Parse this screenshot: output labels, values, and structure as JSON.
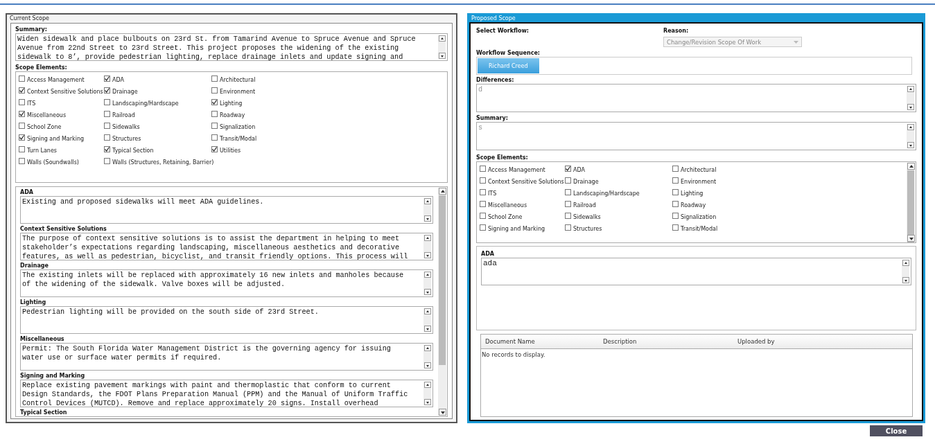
{
  "current_scope": {
    "title": "Current Scope",
    "summary_label": "Summary:",
    "summary": "Widen sidewalk and place bulbouts on 23rd St. from Tamarind Avenue to Spruce Avenue and Spruce\nAvenue from 22nd Street to 23rd Street. This project proposes the widening of the existing\nsidewalk to 8’, provide pedestrian lighting, replace drainage inlets and update signing and",
    "elements_label": "Scope Elements:",
    "elements": [
      {
        "label": "Access Management",
        "checked": false
      },
      {
        "label": "ADA",
        "checked": true
      },
      {
        "label": "Architectural",
        "checked": false
      },
      {
        "label": "Context Sensitive Solutions",
        "checked": true
      },
      {
        "label": "Drainage",
        "checked": true
      },
      {
        "label": "Environment",
        "checked": false
      },
      {
        "label": "ITS",
        "checked": false
      },
      {
        "label": "Landscaping/Hardscape",
        "checked": false
      },
      {
        "label": "Lighting",
        "checked": true
      },
      {
        "label": "Miscellaneous",
        "checked": true
      },
      {
        "label": "Railroad",
        "checked": false
      },
      {
        "label": "Roadway",
        "checked": false
      },
      {
        "label": "School Zone",
        "checked": false
      },
      {
        "label": "Sidewalks",
        "checked": false
      },
      {
        "label": "Signalization",
        "checked": false
      },
      {
        "label": "Signing and Marking",
        "checked": true
      },
      {
        "label": "Structures",
        "checked": false
      },
      {
        "label": "Transit/Modal",
        "checked": false
      },
      {
        "label": "Turn Lanes",
        "checked": false
      },
      {
        "label": "Typical Section",
        "checked": true
      },
      {
        "label": "Utilities",
        "checked": true
      },
      {
        "label": "Walls (Soundwalls)",
        "checked": false
      },
      {
        "label": "Walls (Structures, Retaining, Barrier)",
        "checked": false
      }
    ],
    "details": [
      {
        "label": "ADA",
        "value": "Existing and proposed sidewalks will meet ADA guidelines."
      },
      {
        "label": "Context Sensitive Solutions",
        "value": "The purpose of context sensitive solutions is to assist the department in helping to meet\nstakeholder’s expectations regarding landscaping, miscellaneous aesthetics and decorative\nfeatures, as well as pedestrian, bicyclist, and transit friendly options. This process will"
      },
      {
        "label": "Drainage",
        "value": "The existing inlets will be replaced with approximately 16 new inlets and manholes because\nof the widening of the sidewalk. Valve boxes will be adjusted."
      },
      {
        "label": "Lighting",
        "value": "Pedestrian lighting will be provided on the south side of 23rd Street."
      },
      {
        "label": "Miscellaneous",
        "value": "Permit: The South Florida Water Management District is the governing agency for issuing\nwater use or surface water permits if required."
      },
      {
        "label": "Signing and Marking",
        "value": "Replace existing pavement markings with paint and thermoplastic that conform to current\nDesign Standards, the FDOT Plans Preparation Manual (PPM) and the Manual of Uniform Traffic\nControl Devices (MUTCD). Remove and replace approximately 20 signs. Install overhead"
      },
      {
        "label": "Typical Section"
      }
    ]
  },
  "proposed_scope": {
    "title": "Proposed Scope",
    "workflow_label": "Select Workflow:",
    "reason_label": "Reason:",
    "reason": {
      "value": "Change/Revision Scope Of Work",
      "disabled": true
    },
    "sequence_label": "Workflow Sequence:",
    "sequence": [
      {
        "name": "Richard Creed"
      }
    ],
    "differences_label": "Differences:",
    "differences": "d",
    "summary_label": "Summary:",
    "summary": "s",
    "elements_label": "Scope Elements:",
    "elements": [
      {
        "label": "Access Management",
        "checked": false
      },
      {
        "label": "ADA",
        "checked": true
      },
      {
        "label": "Architectural",
        "checked": false
      },
      {
        "label": "Context Sensitive Solutions",
        "checked": false
      },
      {
        "label": "Drainage",
        "checked": false
      },
      {
        "label": "Environment",
        "checked": false
      },
      {
        "label": "ITS",
        "checked": false
      },
      {
        "label": "Landscaping/Hardscape",
        "checked": false
      },
      {
        "label": "Lighting",
        "checked": false
      },
      {
        "label": "Miscellaneous",
        "checked": false
      },
      {
        "label": "Railroad",
        "checked": false
      },
      {
        "label": "Roadway",
        "checked": false
      },
      {
        "label": "School Zone",
        "checked": false
      },
      {
        "label": "Sidewalks",
        "checked": false
      },
      {
        "label": "Signalization",
        "checked": false
      },
      {
        "label": "Signing and Marking",
        "checked": false
      },
      {
        "label": "Structures",
        "checked": false
      },
      {
        "label": "Transit/Modal",
        "checked": false
      }
    ],
    "details": [
      {
        "label": "ADA",
        "value": "ada"
      }
    ],
    "documents": {
      "columns": [
        "Document Name",
        "Description",
        "Uploaded by"
      ],
      "empty": "No records to display."
    }
  },
  "close_button": "Close"
}
